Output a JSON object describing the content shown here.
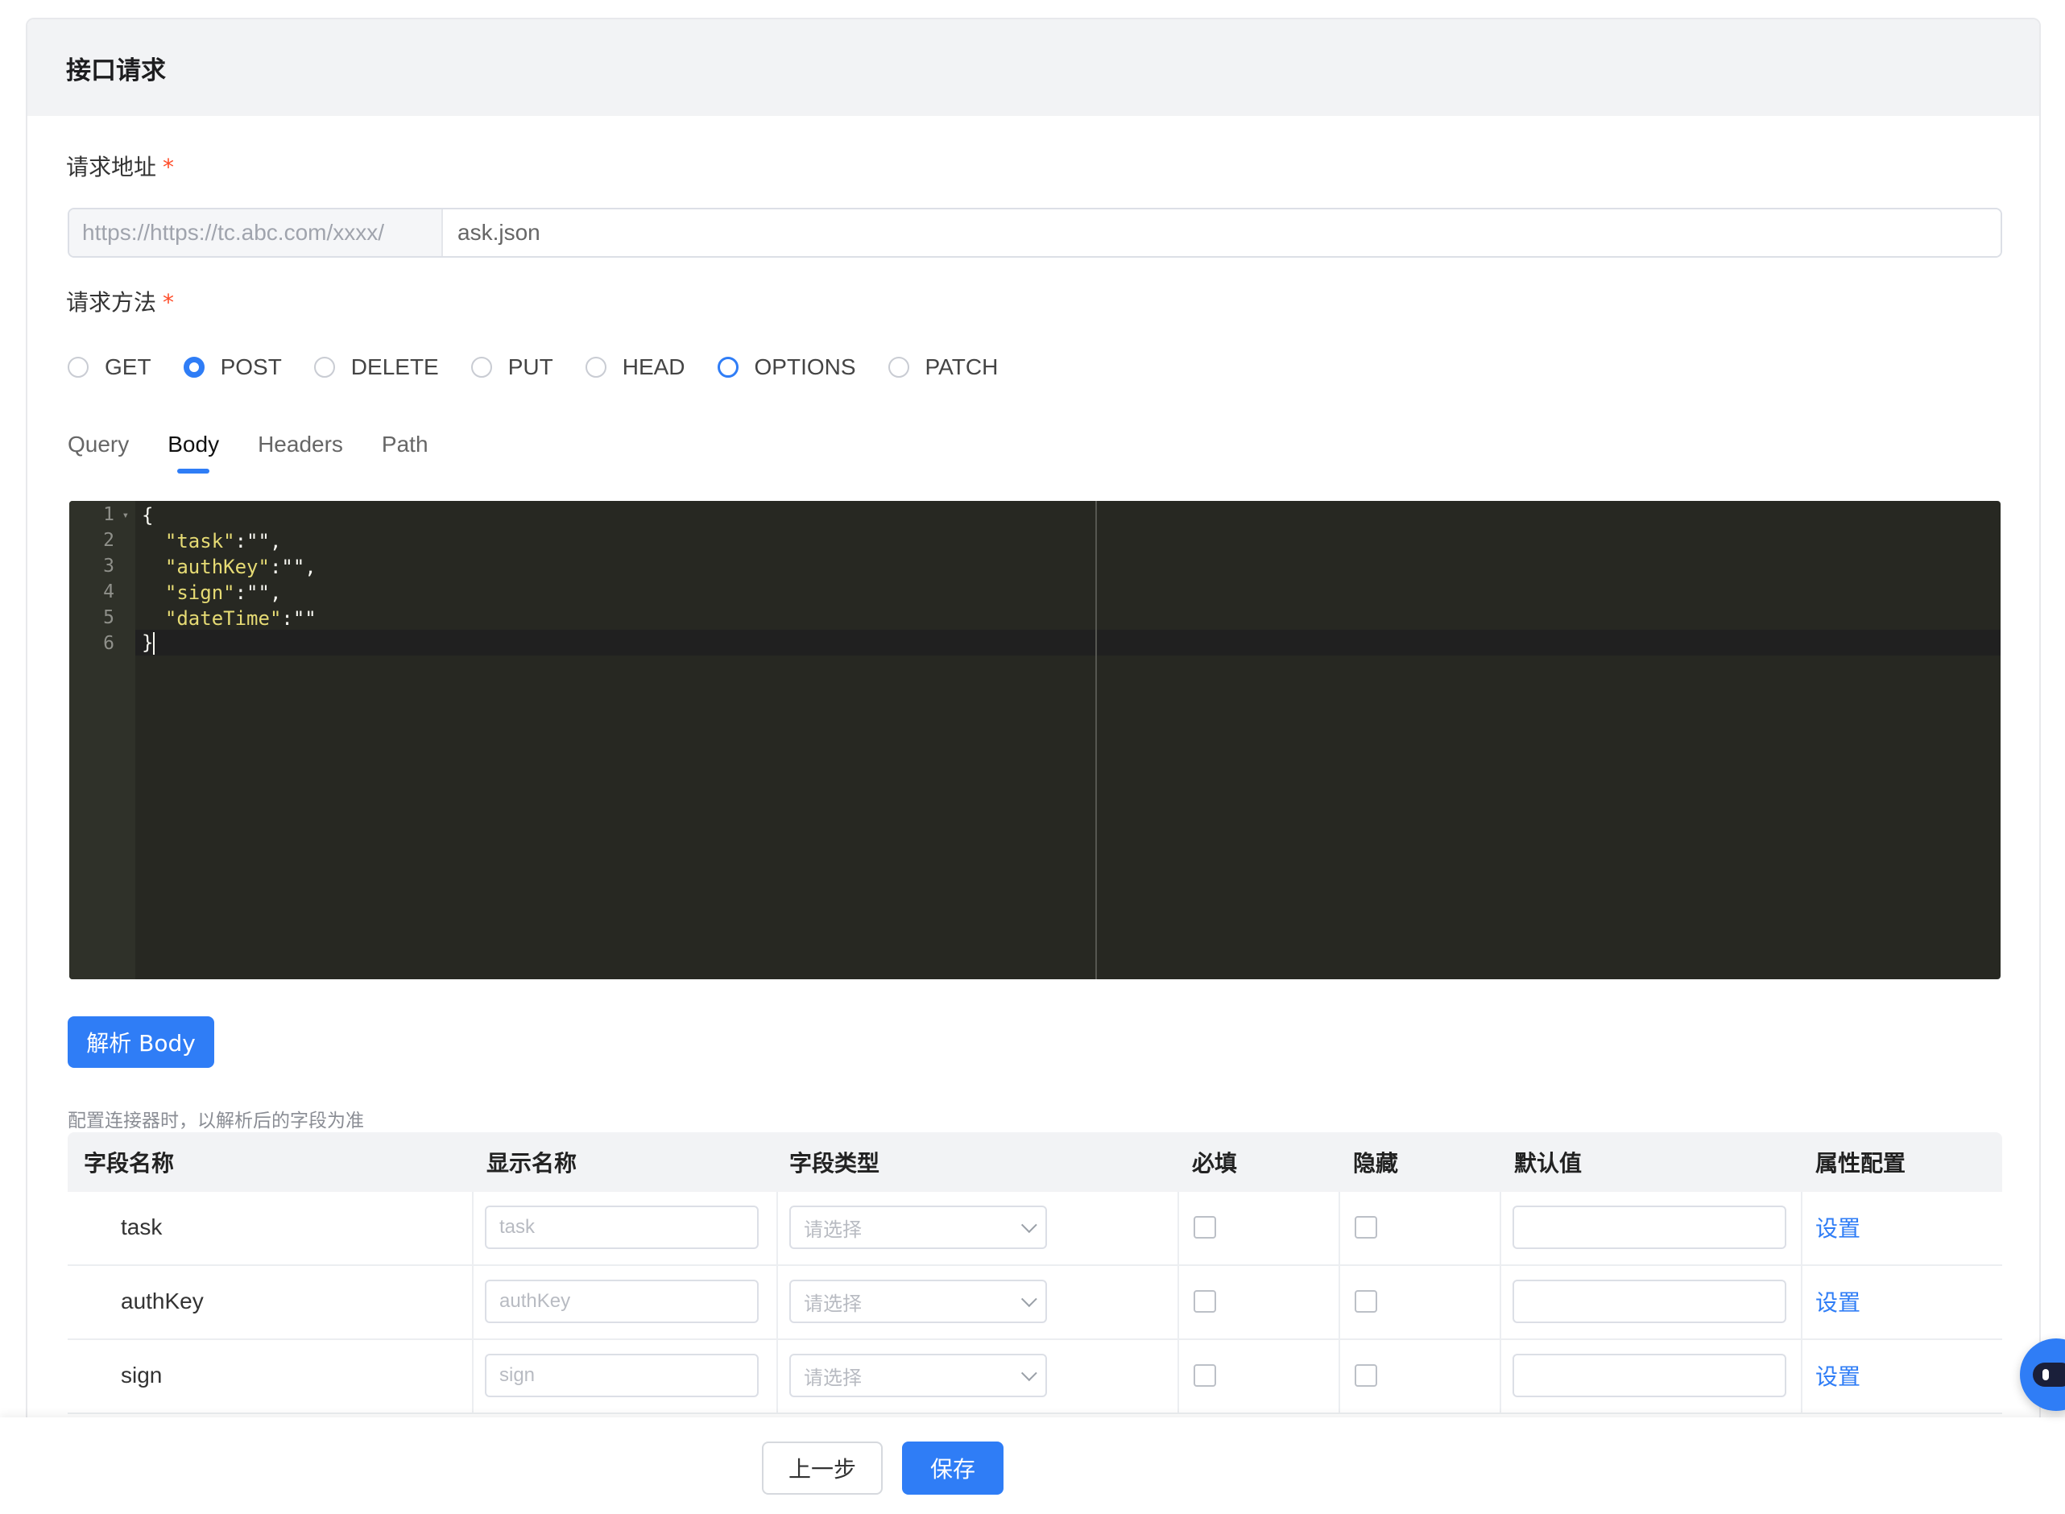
{
  "card": {
    "title": "接口请求"
  },
  "url": {
    "label": "请求地址",
    "required_mark": "*",
    "prefix": "https://https://tc.abc.com/xxxx/",
    "value": "ask.json"
  },
  "method": {
    "label": "请求方法",
    "required_mark": "*",
    "options": [
      "GET",
      "POST",
      "DELETE",
      "PUT",
      "HEAD",
      "OPTIONS",
      "PATCH"
    ],
    "selected": "POST",
    "hovered": "OPTIONS"
  },
  "tabs": {
    "items": [
      "Query",
      "Body",
      "Headers",
      "Path"
    ],
    "active": "Body"
  },
  "editor": {
    "line_numbers": [
      "1",
      "2",
      "3",
      "4",
      "5",
      "6"
    ],
    "lines": [
      "{",
      "  \"task\":\"\",",
      "  \"authKey\":\"\",",
      "  \"sign\":\"\",",
      "  \"dateTime\":\"\"",
      "}"
    ],
    "line1_open": "{",
    "line2_key": "\"task\"",
    "line2_rest": ":\"\",",
    "line3_key": "\"authKey\"",
    "line3_rest": ":\"\",",
    "line4_key": "\"sign\"",
    "line4_rest": ":\"\",",
    "line5_key": "\"dateTime\"",
    "line5_rest": ":\"\"",
    "line6_close": "}"
  },
  "parse_button": {
    "label": "解析 Body"
  },
  "hint": "配置连接器时，以解析后的字段为准",
  "table": {
    "headers": {
      "field_name": "字段名称",
      "display_name": "显示名称",
      "field_type": "字段类型",
      "required": "必填",
      "hidden": "隐藏",
      "default_value": "默认值",
      "attr_config": "属性配置"
    },
    "rows": [
      {
        "field": "task",
        "display_placeholder": "task",
        "type_placeholder": "请选择",
        "default": "",
        "action": "设置"
      },
      {
        "field": "authKey",
        "display_placeholder": "authKey",
        "type_placeholder": "请选择",
        "default": "",
        "action": "设置"
      },
      {
        "field": "sign",
        "display_placeholder": "sign",
        "type_placeholder": "请选择",
        "default": "",
        "action": "设置"
      }
    ]
  },
  "footer": {
    "prev": "上一步",
    "save": "保存"
  },
  "colors": {
    "primary": "#2f7df6",
    "required": "#ff4d2a",
    "editor_bg": "#272822",
    "string": "#e6db74"
  },
  "icons": {
    "assistant": "robot-assistant-icon",
    "dropdown": "chevron-down-icon"
  }
}
